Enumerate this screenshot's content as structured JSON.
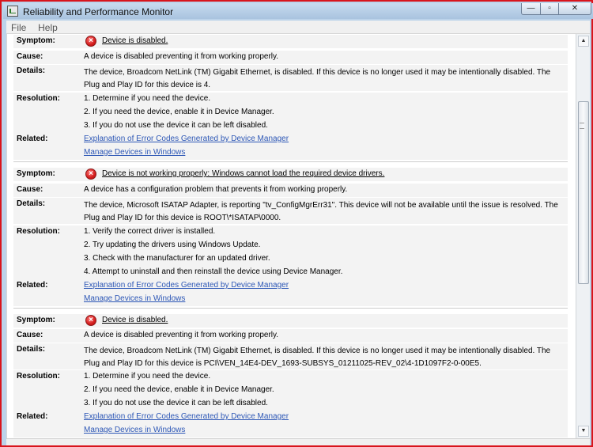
{
  "window": {
    "title": "Reliability and Performance Monitor",
    "buttons": [
      "—",
      "▫",
      "✕"
    ]
  },
  "menu": [
    "File",
    "Help"
  ],
  "labels": {
    "symptom": "Symptom:",
    "cause": "Cause:",
    "details": "Details:",
    "resolution": "Resolution:",
    "related": "Related:"
  },
  "entries": [
    {
      "symptom": "Device is disabled.",
      "cause": "A device is disabled preventing it from working properly.",
      "details": "The device, Broadcom NetLink (TM) Gigabit Ethernet, is disabled. If this device is no longer used it may be intentionally disabled. The Plug and Play ID for this device is 4.",
      "resolution": [
        "1. Determine if you need the device.",
        "2. If you need the device, enable it in Device Manager.",
        "3. If you do not use the device it can be left disabled."
      ],
      "related": [
        "Explanation of Error Codes Generated by Device Manager",
        "Manage Devices in Windows"
      ]
    },
    {
      "symptom": "Device is not working properly: Windows cannot load the required device drivers.",
      "cause": "A device has a configuration problem that prevents it from working properly.",
      "details": "The device, Microsoft ISATAP Adapter, is reporting \"tv_ConfigMgrErr31\". This device will not be available until the issue is resolved. The Plug and Play ID for this device is ROOT\\*ISATAP\\0000.",
      "resolution": [
        "1. Verify the correct driver is installed.",
        "2. Try updating the drivers using Windows Update.",
        "3. Check with the manufacturer for an updated driver.",
        "4. Attempt to uninstall and then reinstall the device using Device Manager."
      ],
      "related": [
        "Explanation of Error Codes Generated by Device Manager",
        "Manage Devices in Windows"
      ]
    },
    {
      "symptom": "Device is disabled.",
      "cause": "A device is disabled preventing it from working properly.",
      "details": "The device, Broadcom NetLink (TM) Gigabit Ethernet, is disabled. If this device is no longer used it may be intentionally disabled. The Plug and Play ID for this device is PCI\\VEN_14E4-DEV_1693-SUBSYS_01211025-REV_02\\4-1D1097F2-0-00E5.",
      "resolution": [
        "1. Determine if you need the device.",
        "2. If you need the device, enable it in Device Manager.",
        "3. If you do not use the device it can be left disabled."
      ],
      "related": [
        "Explanation of Error Codes Generated by Device Manager",
        "Manage Devices in Windows"
      ]
    }
  ]
}
